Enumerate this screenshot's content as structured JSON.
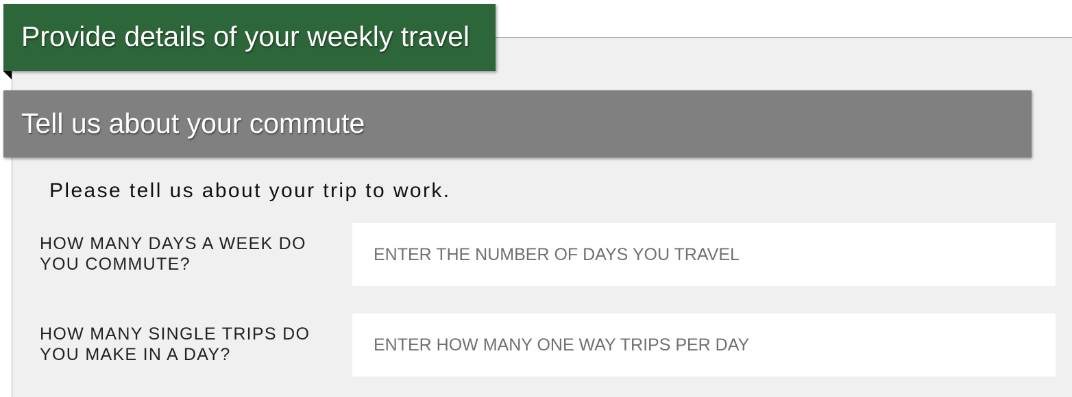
{
  "header": {
    "title": "Provide details of your weekly travel"
  },
  "section": {
    "title": "Tell us about your commute"
  },
  "intro_text": "Please tell us about your trip to work.",
  "questions": [
    {
      "label": "HOW MANY DAYS A WEEK DO YOU COMMUTE?",
      "value": "",
      "placeholder": "ENTER THE NUMBER OF DAYS YOU TRAVEL"
    },
    {
      "label": "HOW MANY SINGLE TRIPS DO YOU MAKE IN A DAY?",
      "value": "",
      "placeholder": "ENTER HOW MANY ONE WAY TRIPS PER DAY"
    }
  ],
  "colors": {
    "header_bg": "#2d6639",
    "section_bg": "#808080",
    "panel_bg": "#f0f0f0",
    "input_bg": "#ffffff"
  }
}
